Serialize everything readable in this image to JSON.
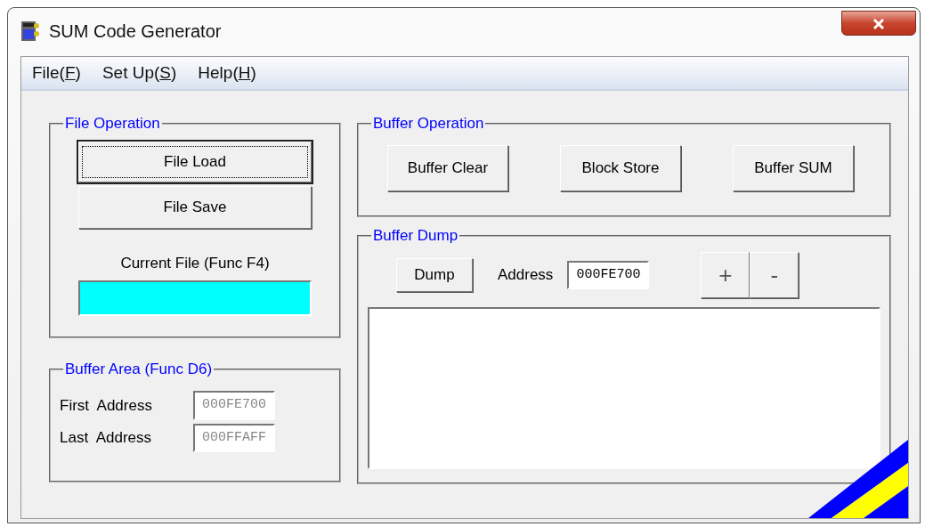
{
  "window": {
    "title": "SUM Code Generator"
  },
  "menu": [
    {
      "label": "File(F)"
    },
    {
      "label": "Set Up(S)"
    },
    {
      "label": "Help(H)"
    }
  ],
  "file_operation": {
    "title": "File Operation",
    "buttons": [
      {
        "label": "File Load",
        "focused": true
      },
      {
        "label": "File Save",
        "focused": false
      }
    ],
    "current_file_label": "Current File (Func F4)"
  },
  "buffer_area": {
    "title": "Buffer Area (Func D6)",
    "fields": [
      {
        "label": "First  Address",
        "value": "000FE700",
        "disabled": true
      },
      {
        "label": "Last  Address",
        "value": "000FFAFF",
        "disabled": true
      }
    ]
  },
  "buffer_operation": {
    "title": "Buffer Operation",
    "buttons": [
      "Buffer Clear",
      "Block Store",
      "Buffer SUM"
    ]
  },
  "buffer_dump": {
    "title": "Buffer Dump",
    "dump_button": "Dump",
    "address_label": "Address",
    "address": {
      "value": "000FE700",
      "disabled": false
    },
    "step_buttons": [
      "+",
      "-"
    ]
  }
}
